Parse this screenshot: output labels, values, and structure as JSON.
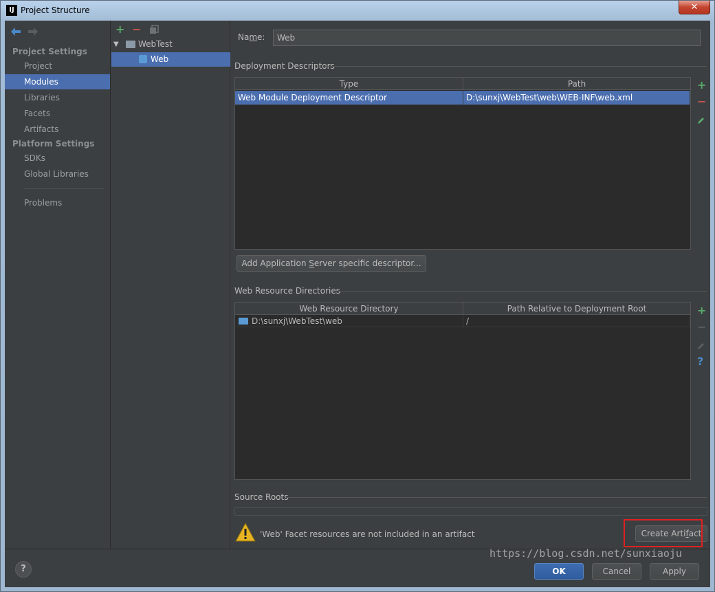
{
  "window": {
    "title": "Project Structure",
    "app_icon_text": "IJ",
    "close_symbol": "✕"
  },
  "nav": {
    "back_icon": "back-arrow-icon",
    "forward_icon": "forward-arrow-icon",
    "project_settings_header": "Project Settings",
    "project_items": [
      {
        "label": "Project"
      },
      {
        "label": "Modules",
        "selected": true
      },
      {
        "label": "Libraries"
      },
      {
        "label": "Facets"
      },
      {
        "label": "Artifacts"
      }
    ],
    "platform_settings_header": "Platform Settings",
    "platform_items": [
      {
        "label": "SDKs"
      },
      {
        "label": "Global Libraries"
      }
    ],
    "problems_label": "Problems"
  },
  "tree": {
    "toolbar": {
      "add_symbol": "+",
      "remove_symbol": "−",
      "copy_icon": "copy-icon"
    },
    "nodes": [
      {
        "label": "WebTest",
        "expanded": true
      },
      {
        "label": "Web",
        "selected": true
      }
    ]
  },
  "main": {
    "name_label_pre": "Na",
    "name_label_u": "m",
    "name_label_post": "e:",
    "name_value": "Web",
    "deployment_descriptors": {
      "title": "Deployment Descriptors",
      "columns": [
        "Type",
        "Path"
      ],
      "rows": [
        {
          "type": "Web Module Deployment Descriptor",
          "path": "D:\\sunxj\\WebTest\\web\\WEB-INF\\web.xml"
        }
      ],
      "add_button_pre": "Add Application ",
      "add_button_u": "S",
      "add_button_post": "erver specific descriptor..."
    },
    "web_resource_directories": {
      "title": "Web Resource Directories",
      "columns": [
        "Web Resource Directory",
        "Path Relative to Deployment Root"
      ],
      "rows": [
        {
          "directory": "D:\\sunxj\\WebTest\\web",
          "relative_path": "/"
        }
      ],
      "help_symbol": "?"
    },
    "source_roots": {
      "title": "Source Roots"
    },
    "warning": {
      "message": "'Web' Facet resources are not included in an artifact",
      "button_pre": "Create Arti",
      "button_u": "f",
      "button_post": "act"
    }
  },
  "footer": {
    "help_symbol": "?",
    "ok_label": "OK",
    "cancel_label": "Cancel",
    "apply_label": "Apply"
  },
  "watermark": "https://blog.csdn.net/sunxiaoju",
  "colors": {
    "selection": "#4b6eaf",
    "background": "#3c3f41",
    "add_green": "#59a869",
    "remove_red": "#c75450",
    "highlight_box": "#e02020"
  }
}
